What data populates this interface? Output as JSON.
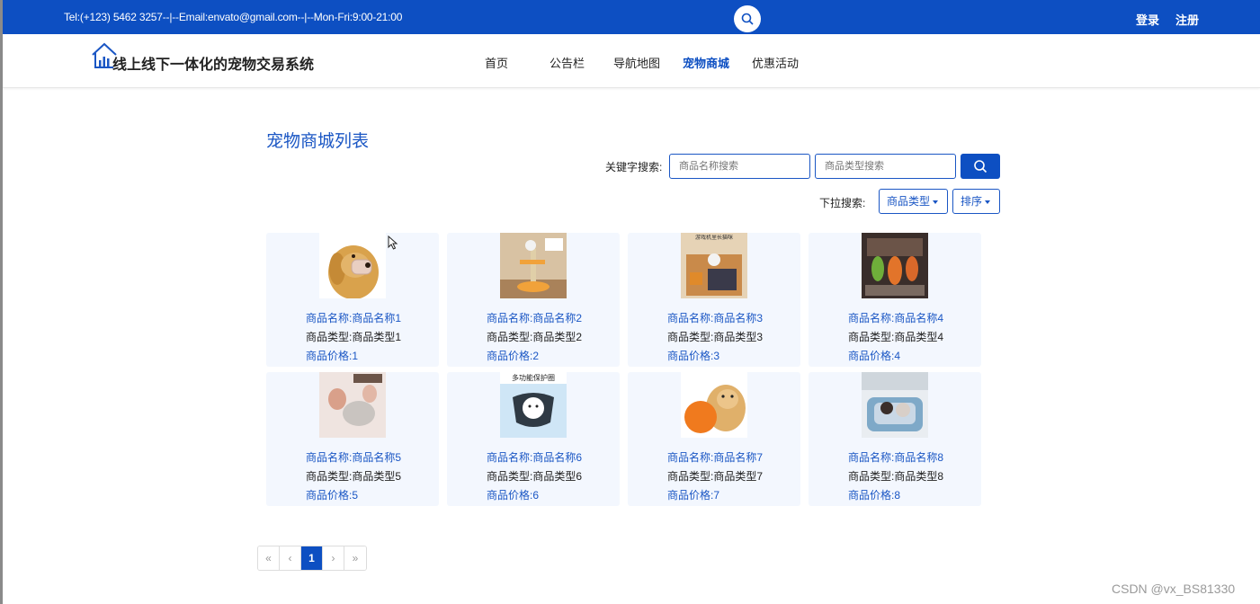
{
  "topbar": {
    "contact": "Tel:(+123) 5462 3257--|--Email:envato@gmail.com--|--Mon-Fri:9:00-21:00",
    "login": "登录",
    "register": "注册"
  },
  "header": {
    "site_title": "线上线下一体化的宠物交易系统",
    "nav": [
      "首页",
      "公告栏",
      "导航地图",
      "宠物商城",
      "优惠活动"
    ],
    "active_nav": "宠物商城"
  },
  "main": {
    "page_title": "宠物商城列表",
    "keyword_label": "关键字搜索:",
    "name_placeholder": "商品名称搜索",
    "type_placeholder": "商品类型搜索",
    "dropdown_label": "下拉搜索:",
    "type_dropdown": "商品类型",
    "sort_dropdown": "排序"
  },
  "products": [
    {
      "name": "商品名称:商品名称1",
      "type": "商品类型:商品类型1",
      "price": "商品价格:1",
      "image": "golden-retriever-muzzle"
    },
    {
      "name": "商品名称:商品名称2",
      "type": "商品类型:商品类型2",
      "price": "商品价格:2",
      "image": "cat-tree"
    },
    {
      "name": "商品名称:商品名称3",
      "type": "商品类型:商品类型3",
      "price": "商品价格:3",
      "image": "cat-game-house",
      "image_text": "游戏机里长猫咪"
    },
    {
      "name": "商品名称:商品名称4",
      "type": "商品类型:商品类型4",
      "price": "商品价格:4",
      "image": "pet-toys-rack"
    },
    {
      "name": "商品名称:商品名称5",
      "type": "商品类型:商品类型5",
      "price": "商品价格:5",
      "image": "pet-grooming"
    },
    {
      "name": "商品名称:商品名称6",
      "type": "商品类型:商品类型6",
      "price": "商品价格:6",
      "image": "dog-cone-collar",
      "image_text": "多功能保护圈"
    },
    {
      "name": "商品名称:商品名称7",
      "type": "商品类型:商品类型7",
      "price": "商品价格:7",
      "image": "dog-frisbee"
    },
    {
      "name": "商品名称:商品名称8",
      "type": "商品类型:商品类型8",
      "price": "商品价格:8",
      "image": "dog-bed"
    }
  ],
  "pagination": {
    "first": "«",
    "prev": "‹",
    "current": "1",
    "next": "›",
    "last": "»"
  },
  "watermark": "CSDN @vx_BS81330",
  "colors": {
    "primary": "#0d4fc2",
    "link": "#1a56c4",
    "card_bg": "#f3f7fe"
  }
}
